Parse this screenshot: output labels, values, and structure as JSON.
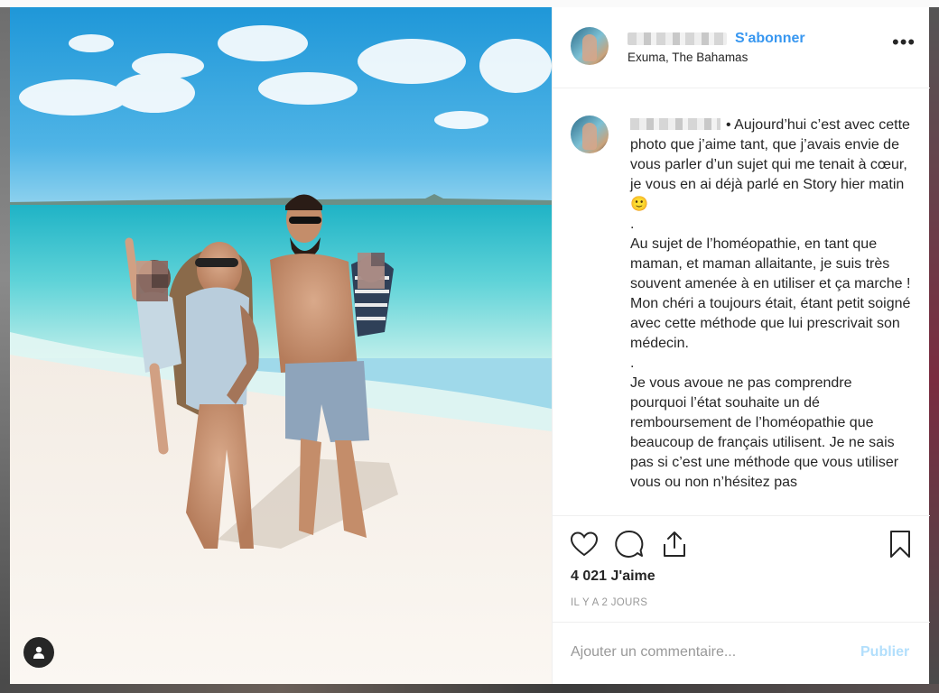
{
  "post": {
    "header": {
      "follow_label": "S'abonner",
      "location": "Exuma, The Bahamas",
      "more_icon": "more-horizontal-icon"
    },
    "caption": {
      "text": "• Aujourd’hui c’est avec cette photo que j’aime tant, que j’avais envie de vous parler d’un sujet qui me tenait à cœur, je vous en ai déjà parlé en Story hier matin 🙂\n.\nAu sujet de l’homéopathie, en tant que maman, et maman allaitante, je suis très souvent amenée à en utiliser et ça marche ! Mon chéri a toujours était, étant petit soigné avec cette méthode que lui prescrivait son médecin.\n.\nJe vous avoue ne pas comprendre pourquoi l’état souhaite un dé remboursement de l’homéopathie que beaucoup de français utilisent. Je ne sais pas si c’est une méthode que vous utiliser vous ou non n’hésitez pas"
    },
    "likes": "4 021 J'aime",
    "timestamp": "IL Y A 2 JOURS",
    "comment_placeholder": "Ajouter un commentaire...",
    "publish_label": "Publier"
  },
  "colors": {
    "link_blue": "#3897f0",
    "publish_disabled": "#b2dffc",
    "text": "#262626",
    "muted": "#999999"
  }
}
